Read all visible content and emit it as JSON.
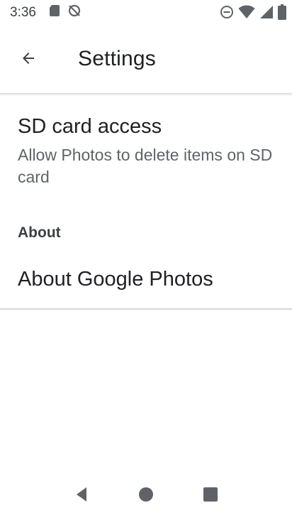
{
  "status_bar": {
    "time": "3:36",
    "left_icons": [
      "sd-card-icon",
      "no-sync-icon"
    ],
    "right_icons": [
      "do-not-disturb-icon",
      "wifi-icon",
      "signal-icon",
      "battery-icon"
    ]
  },
  "app_bar": {
    "title": "Settings",
    "back_icon": "back-arrow-icon"
  },
  "settings": {
    "sd_card": {
      "title": "SD card access",
      "summary": "Allow Photos to delete items on SD card"
    },
    "about_section": {
      "header": "About",
      "item_title": "About Google Photos"
    }
  },
  "nav_bar": {
    "icons": [
      "back-icon",
      "home-icon",
      "recents-icon"
    ]
  },
  "colors": {
    "icon_gray": "#5f6368",
    "text_primary": "#202124",
    "text_secondary": "#5f6368"
  }
}
